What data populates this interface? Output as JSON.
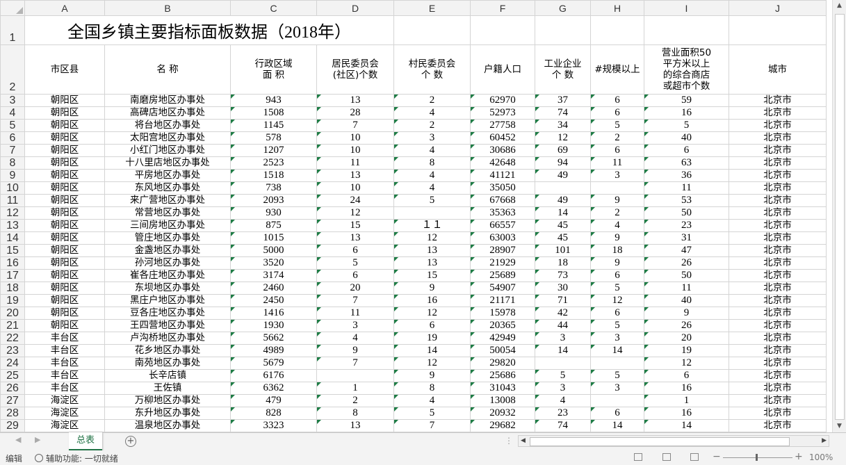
{
  "columns": [
    "A",
    "B",
    "C",
    "D",
    "E",
    "F",
    "G",
    "H",
    "I",
    "J"
  ],
  "title": "全国乡镇主要指标面板数据（2018年）",
  "headers": [
    "市区县",
    "名 称",
    "行政区域\n面 积",
    "居民委员会\n(社区)个数",
    "村民委员会\n个 数",
    "户籍人口",
    "工业企业\n个 数",
    "#规模以上",
    "营业面积50\n平方米以上\n的综合商店\n或超市个数",
    "城市"
  ],
  "rows": [
    [
      "3",
      "朝阳区",
      "南磨房地区办事处",
      "943",
      "13",
      "2",
      "62970",
      "37",
      "6",
      "59",
      "北京市"
    ],
    [
      "4",
      "朝阳区",
      "高碑店地区办事处",
      "1508",
      "28",
      "4",
      "52973",
      "74",
      "6",
      "16",
      "北京市"
    ],
    [
      "5",
      "朝阳区",
      "将台地区办事处",
      "1145",
      "7",
      "2",
      "27758",
      "34",
      "5",
      "5",
      "北京市"
    ],
    [
      "6",
      "朝阳区",
      "太阳宫地区办事处",
      "578",
      "10",
      "3",
      "60452",
      "12",
      "2",
      "40",
      "北京市"
    ],
    [
      "7",
      "朝阳区",
      "小红门地区办事处",
      "1207",
      "10",
      "4",
      "30686",
      "69",
      "6",
      "6",
      "北京市"
    ],
    [
      "8",
      "朝阳区",
      "十八里店地区办事处",
      "2523",
      "11",
      "8",
      "42648",
      "94",
      "11",
      "63",
      "北京市"
    ],
    [
      "9",
      "朝阳区",
      "平房地区办事处",
      "1518",
      "13",
      "4",
      "41121",
      "49",
      "3",
      "36",
      "北京市"
    ],
    [
      "10",
      "朝阳区",
      "东风地区办事处",
      "738",
      "10",
      "4",
      "35050",
      "",
      "",
      "11",
      "北京市"
    ],
    [
      "11",
      "朝阳区",
      "来广营地区办事处",
      "2093",
      "24",
      "5",
      "67668",
      "49",
      "9",
      "53",
      "北京市"
    ],
    [
      "12",
      "朝阳区",
      "常营地区办事处",
      "930",
      "12",
      "",
      "35363",
      "14",
      "2",
      "50",
      "北京市"
    ],
    [
      "13",
      "朝阳区",
      "三间房地区办事处",
      "875",
      "15",
      "１１",
      "66557",
      "45",
      "4",
      "23",
      "北京市"
    ],
    [
      "14",
      "朝阳区",
      "管庄地区办事处",
      "1015",
      "13",
      "12",
      "63003",
      "45",
      "9",
      "31",
      "北京市"
    ],
    [
      "15",
      "朝阳区",
      "金盏地区办事处",
      "5000",
      "6",
      "13",
      "28907",
      "101",
      "18",
      "47",
      "北京市"
    ],
    [
      "16",
      "朝阳区",
      "孙河地区办事处",
      "3520",
      "5",
      "13",
      "21929",
      "18",
      "9",
      "26",
      "北京市"
    ],
    [
      "17",
      "朝阳区",
      "崔各庄地区办事处",
      "3174",
      "6",
      "15",
      "25689",
      "73",
      "6",
      "50",
      "北京市"
    ],
    [
      "18",
      "朝阳区",
      "东坝地区办事处",
      "2460",
      "20",
      "9",
      "54907",
      "30",
      "5",
      "11",
      "北京市"
    ],
    [
      "19",
      "朝阳区",
      "黑庄户地区办事处",
      "2450",
      "7",
      "16",
      "21171",
      "71",
      "12",
      "40",
      "北京市"
    ],
    [
      "20",
      "朝阳区",
      "豆各庄地区办事处",
      "1416",
      "11",
      "12",
      "15978",
      "42",
      "6",
      "9",
      "北京市"
    ],
    [
      "21",
      "朝阳区",
      "王四营地区办事处",
      "1930",
      "3",
      "6",
      "20365",
      "44",
      "5",
      "26",
      "北京市"
    ],
    [
      "22",
      "丰台区",
      "卢沟桥地区办事处",
      "5662",
      "4",
      "19",
      "42949",
      "3",
      "3",
      "20",
      "北京市"
    ],
    [
      "23",
      "丰台区",
      "花乡地区办事处",
      "4989",
      "9",
      "14",
      "50054",
      "14",
      "14",
      "19",
      "北京市"
    ],
    [
      "24",
      "丰台区",
      "南苑地区办事处",
      "5679",
      "7",
      "12",
      "29820",
      "",
      "",
      "12",
      "北京市"
    ],
    [
      "25",
      "丰台区",
      "长辛店镇",
      "6176",
      "",
      "9",
      "25686",
      "5",
      "5",
      "6",
      "北京市"
    ],
    [
      "26",
      "丰台区",
      "王佐镇",
      "6362",
      "1",
      "8",
      "31043",
      "3",
      "3",
      "16",
      "北京市"
    ],
    [
      "27",
      "海淀区",
      "万柳地区办事处",
      "479",
      "2",
      "4",
      "13008",
      "4",
      "",
      "1",
      "北京市"
    ],
    [
      "28",
      "海淀区",
      "东升地区办事处",
      "828",
      "8",
      "5",
      "20932",
      "23",
      "6",
      "16",
      "北京市"
    ],
    [
      "29",
      "海淀区",
      "温泉地区办事处",
      "3323",
      "13",
      "7",
      "29682",
      "74",
      "14",
      "14",
      "北京市"
    ]
  ],
  "sheet_tab": "总表",
  "status": {
    "mode": "编辑",
    "accessibility": "辅助功能: 一切就绪",
    "zoom": "100%"
  }
}
